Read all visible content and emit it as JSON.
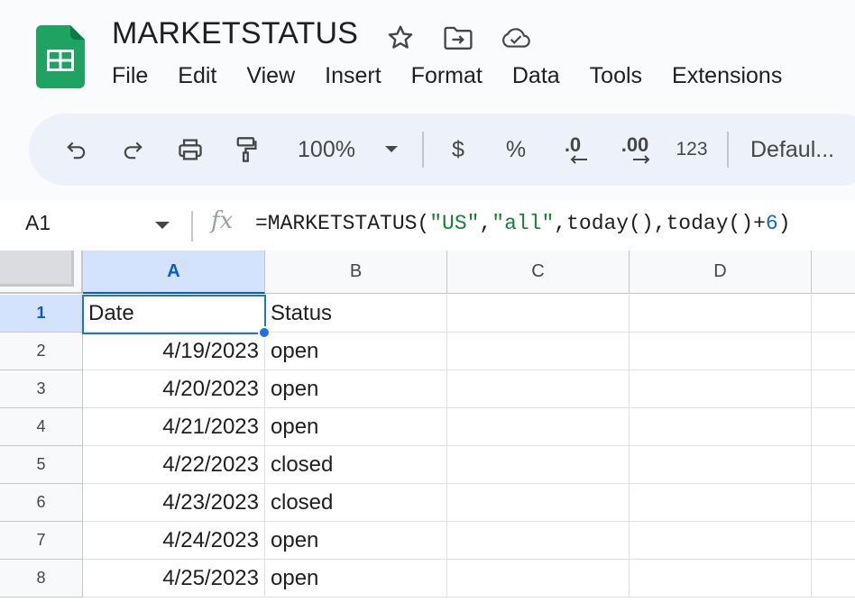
{
  "app": {
    "title": "MARKETSTATUS",
    "icons": [
      "star-icon",
      "move-to-folder-icon",
      "cloud-saved-icon"
    ]
  },
  "menu": [
    "File",
    "Edit",
    "View",
    "Insert",
    "Format",
    "Data",
    "Tools",
    "Extensions"
  ],
  "toolbar": {
    "zoom": "100%",
    "currency": "$",
    "percent": "%",
    "decrease_decimal": ".0",
    "increase_decimal": ".00",
    "number_format": "123",
    "font": "Defaul..."
  },
  "formula_bar": {
    "name_box": "A1",
    "fx": "fx",
    "formula": {
      "prefix": "=MARKETSTATUS(",
      "arg1": "\"US\"",
      "comma1": ",",
      "arg2": "\"all\"",
      "middle": ",today(),today()+",
      "arg3": "6",
      "suffix": ")"
    }
  },
  "grid": {
    "columns": [
      "A",
      "B",
      "C",
      "D"
    ],
    "selected_column": "A",
    "row_numbers": [
      "1",
      "2",
      "3",
      "4",
      "5",
      "6",
      "7",
      "8"
    ],
    "selected_row": "1",
    "rows": [
      [
        "Date",
        "Status"
      ],
      [
        "4/19/2023",
        "open"
      ],
      [
        "4/20/2023",
        "open"
      ],
      [
        "4/21/2023",
        "open"
      ],
      [
        "4/22/2023",
        "closed"
      ],
      [
        "4/23/2023",
        "closed"
      ],
      [
        "4/24/2023",
        "open"
      ],
      [
        "4/25/2023",
        "open"
      ]
    ]
  },
  "colors": {
    "accent": "#1a73e8",
    "sheets_green": "#0f9d58",
    "selected_header": "#d3e3fd",
    "string_literal": "#188038",
    "number_literal": "#1967d2"
  }
}
